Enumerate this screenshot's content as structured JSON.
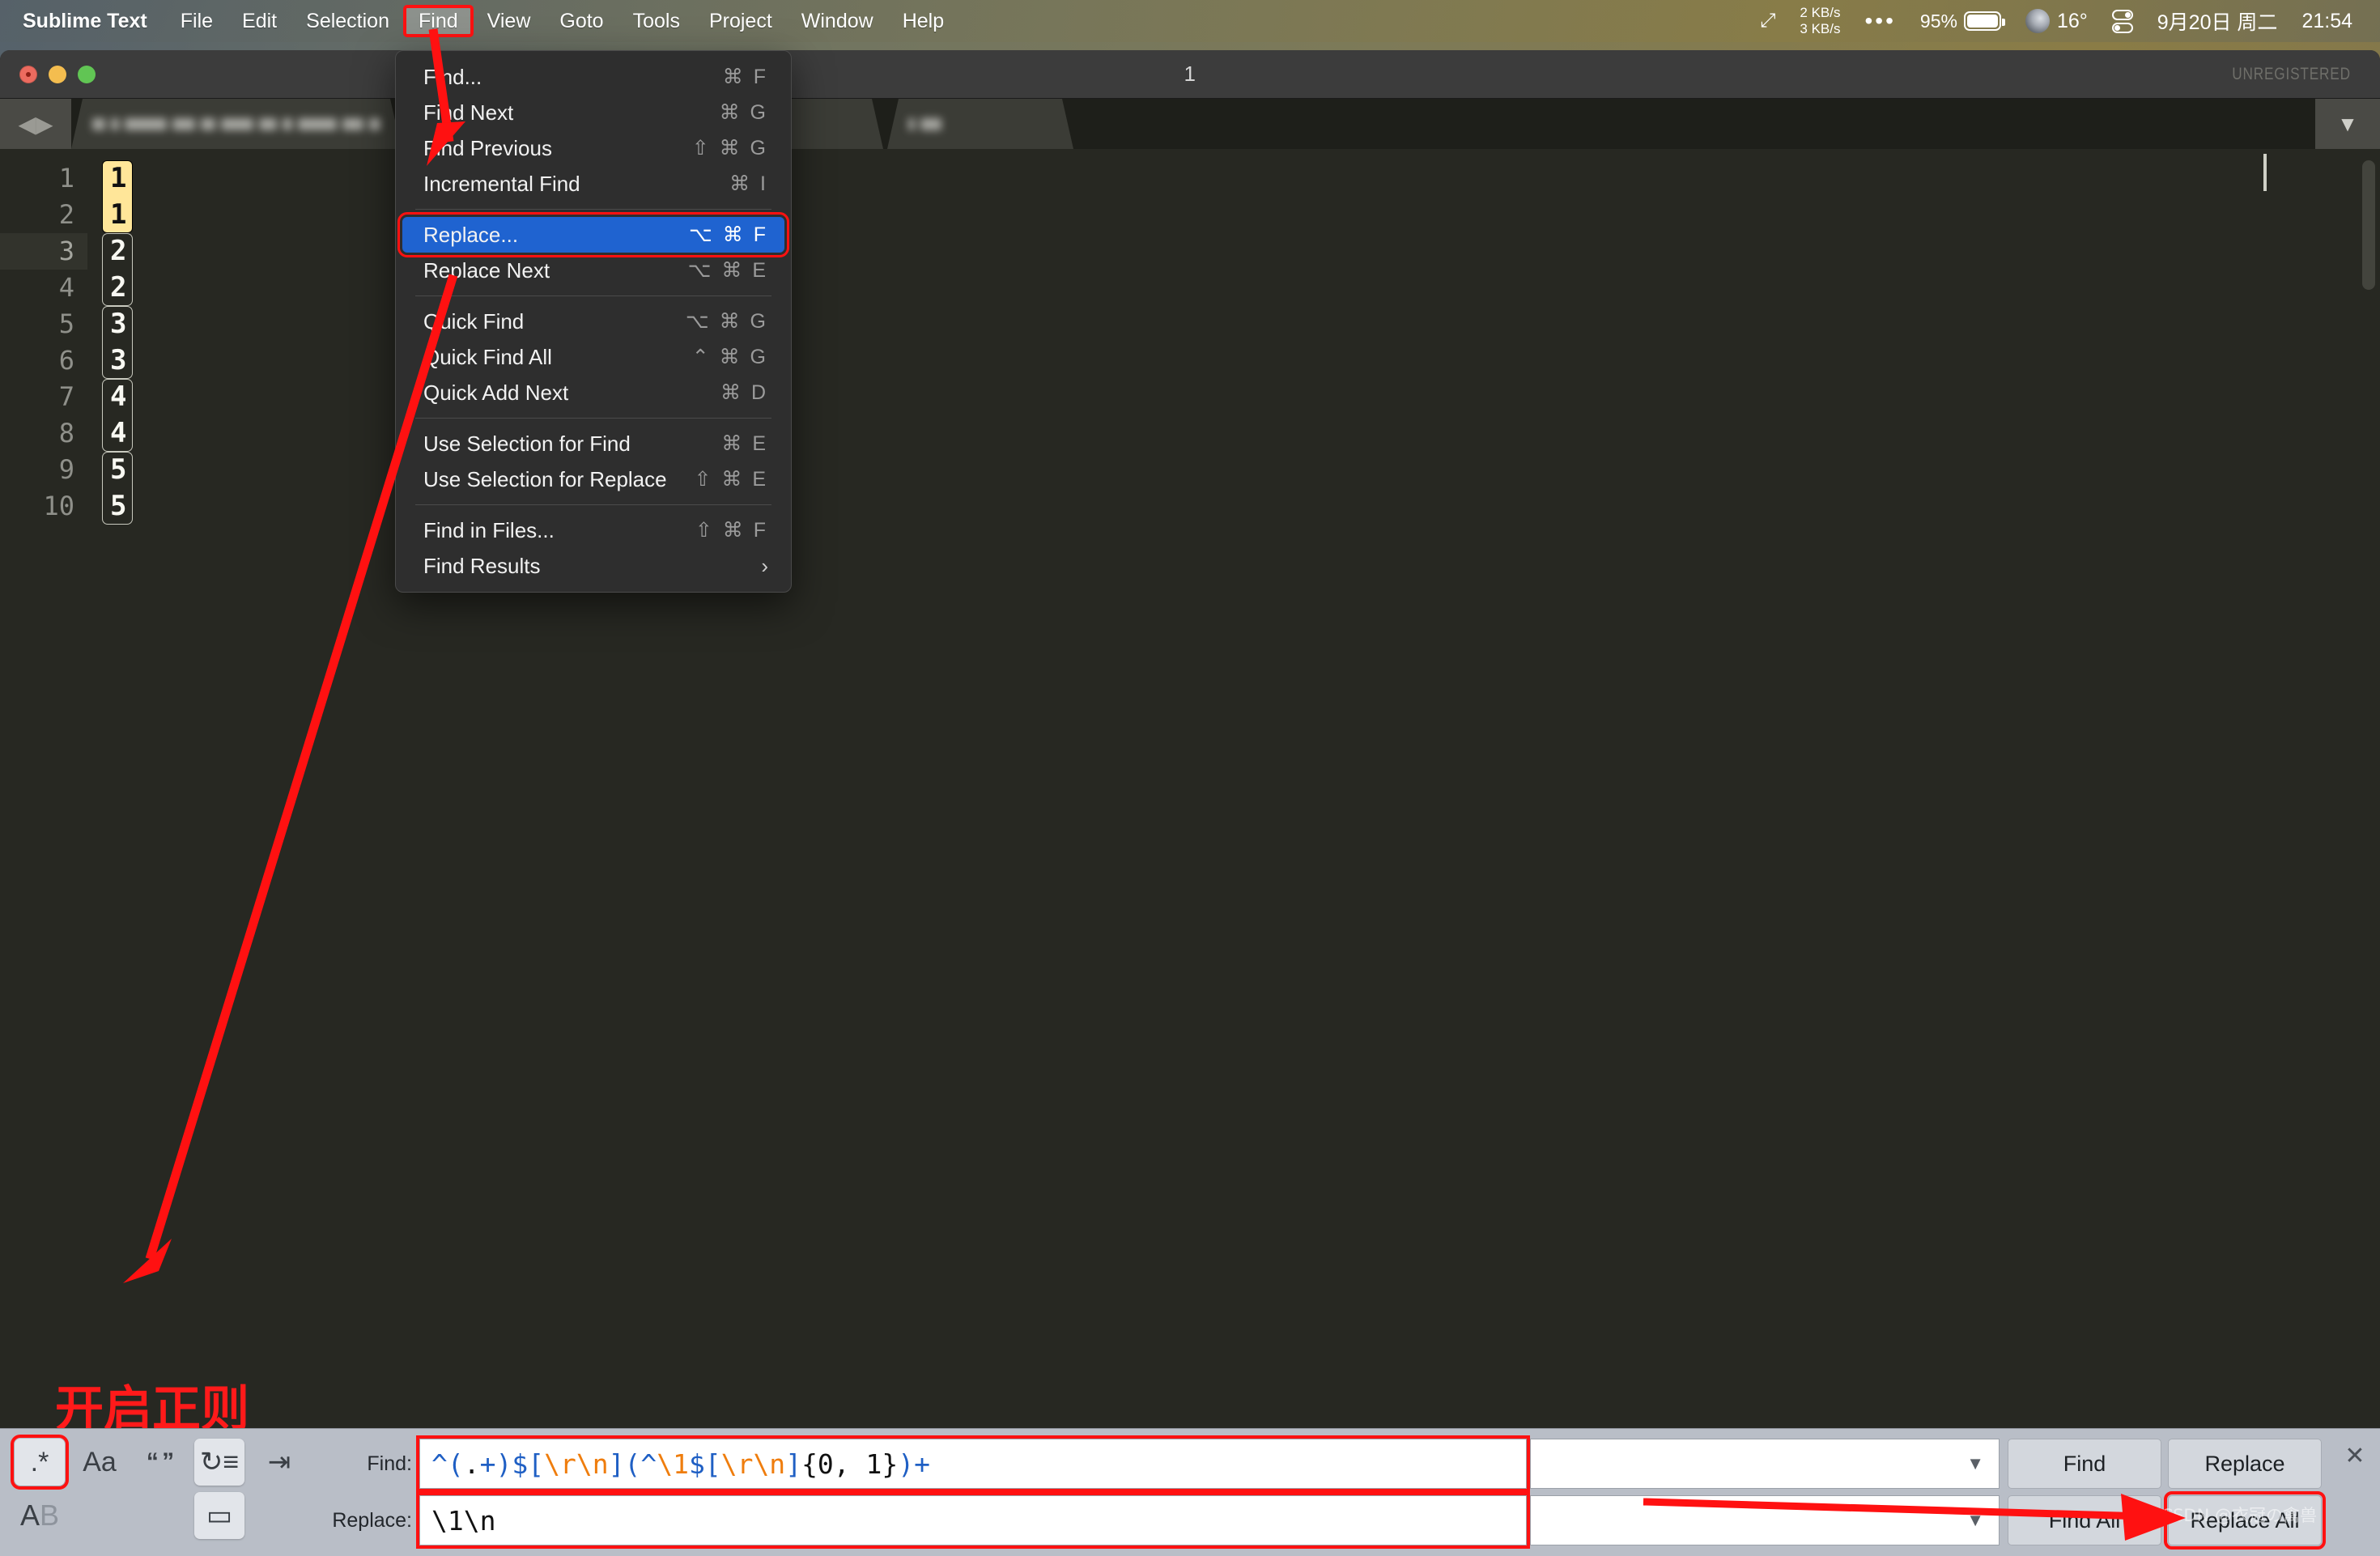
{
  "menubar": {
    "app": "Sublime Text",
    "items": [
      "File",
      "Edit",
      "Selection",
      "Find",
      "View",
      "Goto",
      "Tools",
      "Project",
      "Window",
      "Help"
    ],
    "active_item": "Find",
    "status": {
      "arrows_icon": "diagonal-arrows-icon",
      "net_up": "2 KB/s",
      "net_down": "3 KB/s",
      "dots": "•••",
      "battery_pct": "95%",
      "battery_icon": "battery-icon",
      "moon_icon": "moon-icon",
      "temperature": "16°",
      "control_center_icon": "control-center-icon",
      "date": "9月20日 周二",
      "time": "21:54"
    }
  },
  "window": {
    "title": "1",
    "unregistered": "UNREGISTERED",
    "traffic_lights": [
      "close",
      "minimize",
      "zoom"
    ],
    "tab_nav_icon": "back-forward-arrows-icon",
    "tab_overflow_icon": "chevron-down-icon"
  },
  "editor": {
    "line_numbers": [
      "1",
      "2",
      "3",
      "4",
      "5",
      "6",
      "7",
      "8",
      "9",
      "10"
    ],
    "current_line": "3",
    "lines": [
      "1",
      "1",
      "2",
      "2",
      "3",
      "3",
      "4",
      "4",
      "5",
      "5"
    ]
  },
  "menu": {
    "name": "Find",
    "groups": [
      {
        "items": [
          {
            "label": "Find...",
            "keys": "⌘ F",
            "selected": false
          },
          {
            "label": "Find Next",
            "keys": "⌘ G",
            "selected": false
          },
          {
            "label": "Find Previous",
            "keys": "⇧ ⌘ G",
            "selected": false
          },
          {
            "label": "Incremental Find",
            "keys": "⌘ I",
            "selected": false
          }
        ]
      },
      {
        "items": [
          {
            "label": "Replace...",
            "keys": "⌥ ⌘ F",
            "selected": true
          },
          {
            "label": "Replace Next",
            "keys": "⌥ ⌘ E",
            "selected": false
          }
        ]
      },
      {
        "items": [
          {
            "label": "Quick Find",
            "keys": "⌥ ⌘ G",
            "selected": false
          },
          {
            "label": "Quick Find All",
            "keys": "⌃ ⌘ G",
            "selected": false
          },
          {
            "label": "Quick Add Next",
            "keys": "⌘ D",
            "selected": false
          }
        ]
      },
      {
        "items": [
          {
            "label": "Use Selection for Find",
            "keys": "⌘ E",
            "selected": false
          },
          {
            "label": "Use Selection for Replace",
            "keys": "⇧ ⌘ E",
            "selected": false
          }
        ]
      },
      {
        "items": [
          {
            "label": "Find in Files...",
            "keys": "⇧ ⌘ F",
            "selected": false
          },
          {
            "label": "Find Results",
            "keys": "›",
            "selected": false,
            "submenu": true
          }
        ]
      }
    ]
  },
  "find_panel": {
    "toggles_row1": [
      {
        "name": "regex-toggle",
        "glyph": ".*",
        "on": true,
        "highlighted": true
      },
      {
        "name": "case-sensitive-toggle",
        "glyph": "Aa",
        "on": false,
        "highlighted": false
      },
      {
        "name": "whole-word-toggle",
        "glyph": "“ ”",
        "on": false,
        "highlighted": false
      },
      {
        "name": "wrap-toggle",
        "glyph": "↻≡",
        "on": true,
        "highlighted": false
      },
      {
        "name": "in-selection-toggle",
        "glyph": "⇥",
        "on": false,
        "highlighted": false
      }
    ],
    "toggles_row2": [
      {
        "name": "preserve-case-toggle",
        "glyph": "AB",
        "on": false,
        "highlighted": false
      },
      {
        "name": "show-context-toggle",
        "glyph": "▭",
        "on": true,
        "highlighted": false
      }
    ],
    "find_label": "Find:",
    "find_value": "^(.+)$[\\r\\n](^\\1$[\\r\\n]{0, 1})+",
    "replace_label": "Replace:",
    "replace_value": "\\1\\n",
    "history_dropdown_icon": "chevron-down-icon",
    "buttons": {
      "find": "Find",
      "replace": "Replace",
      "find_all": "Find All",
      "replace_all": "Replace All"
    },
    "close_icon": "close-x-icon"
  },
  "annotations": {
    "chinese_note": "开启正则",
    "watermark": "CSDN @衣冠の禽兽",
    "arrow_color": "#ff1111"
  }
}
